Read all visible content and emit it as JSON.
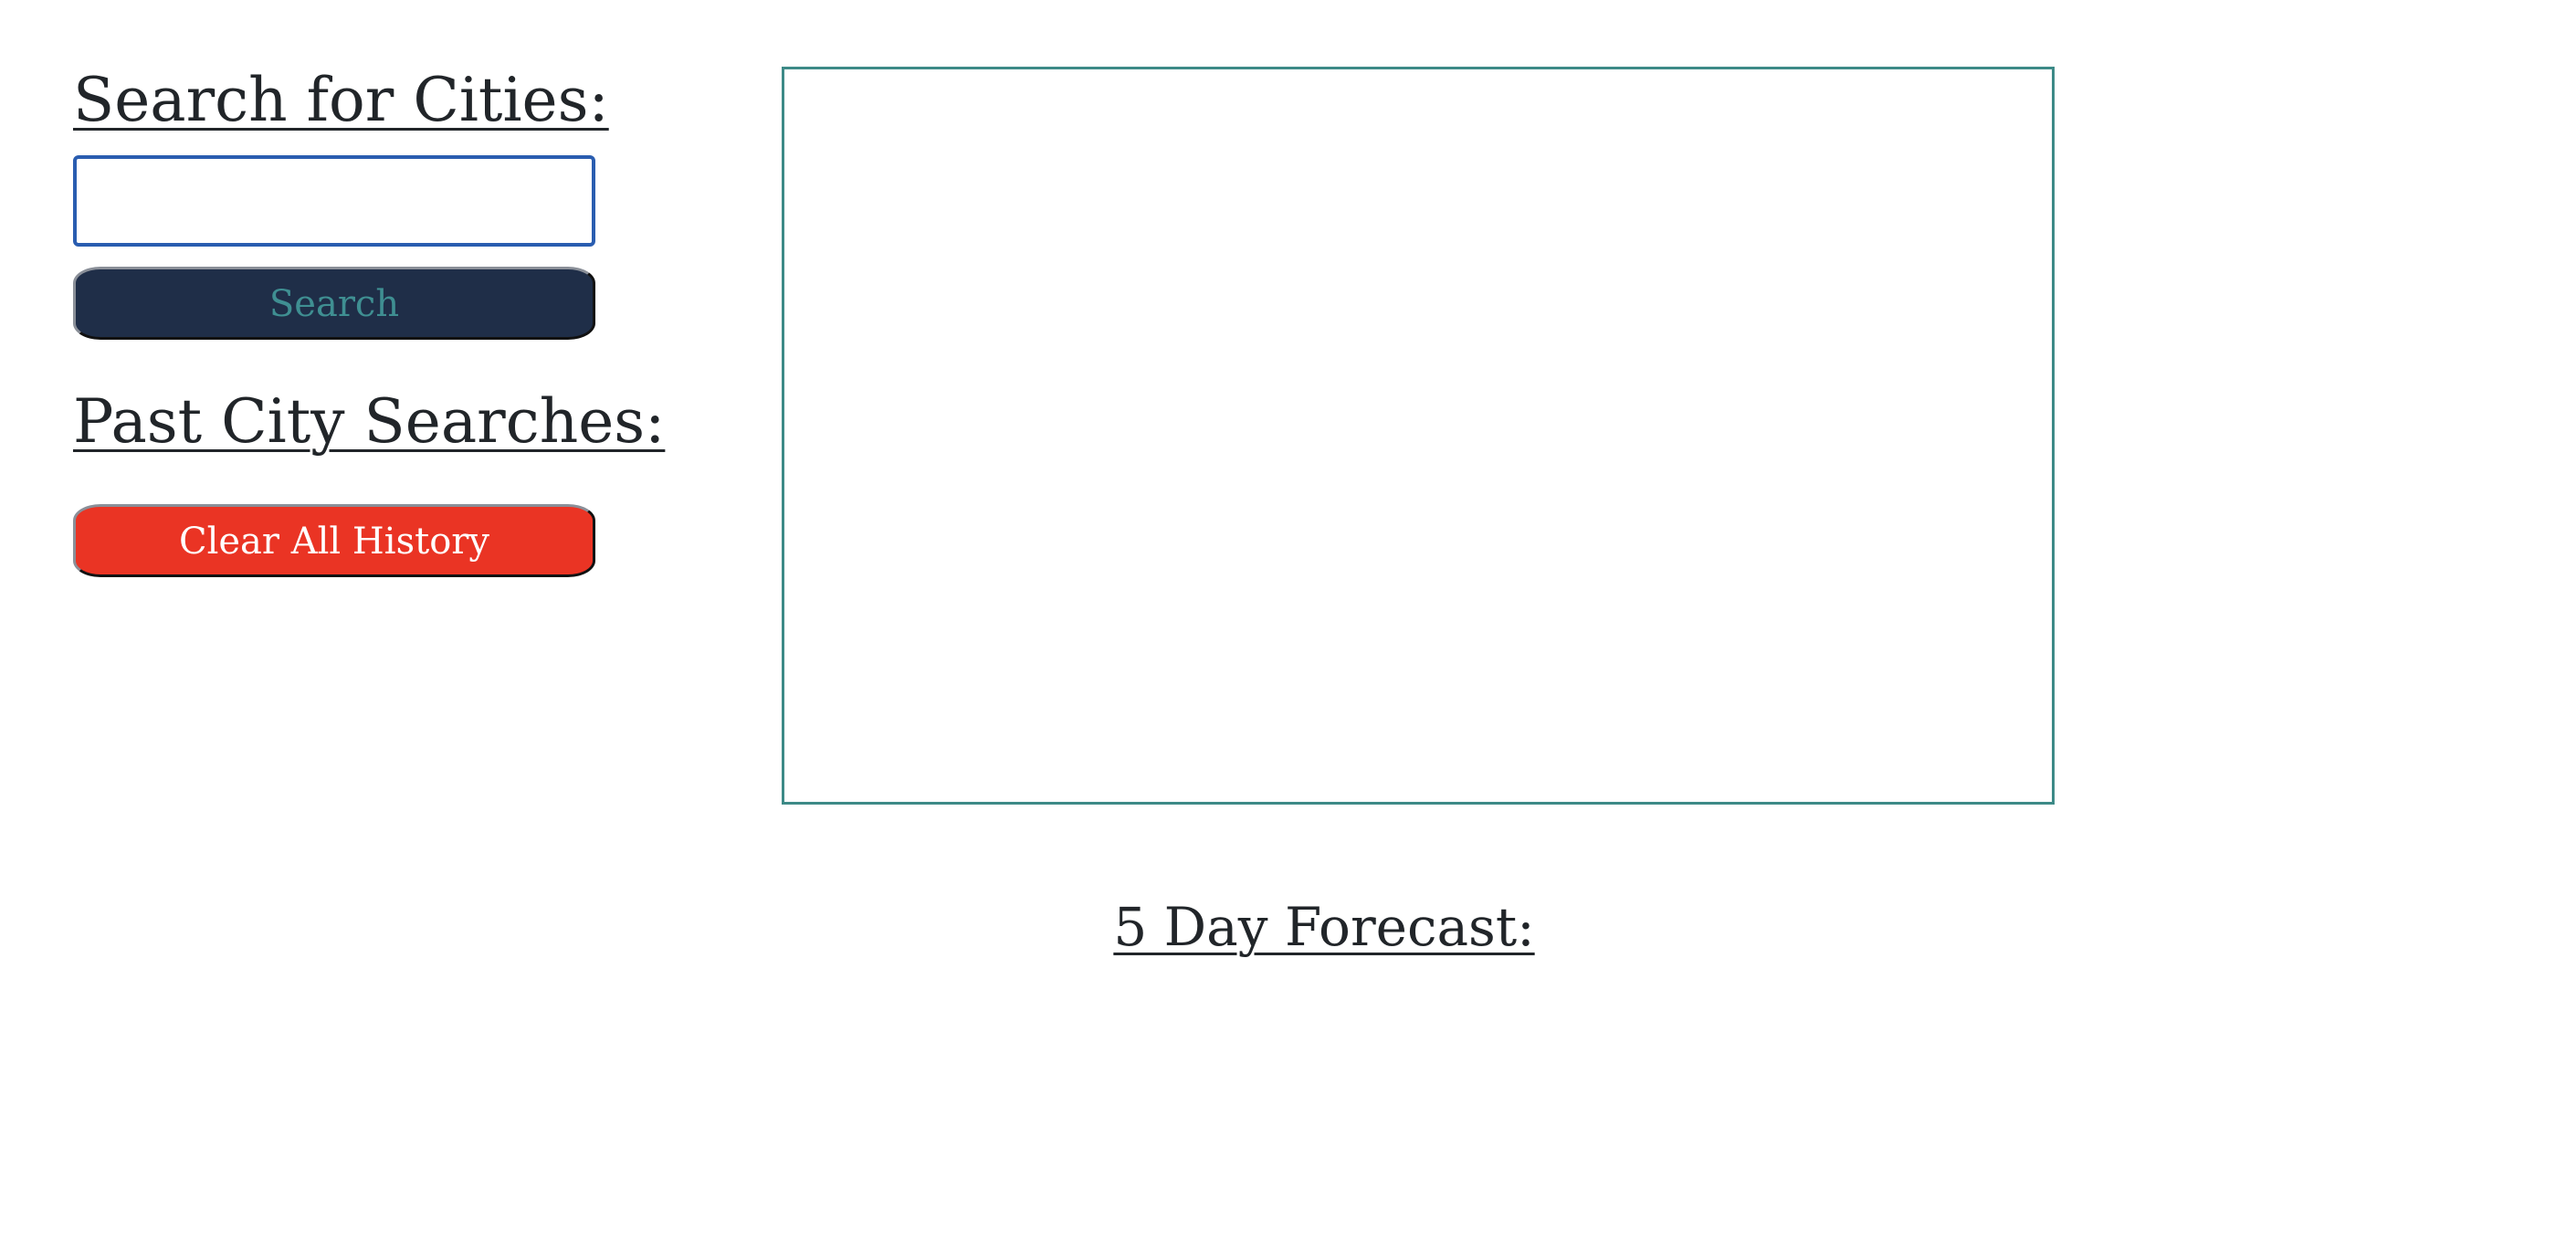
{
  "sidebar": {
    "search_heading": "Search for Cities:",
    "search_input": {
      "value": "",
      "placeholder": ""
    },
    "search_button_label": "Search",
    "past_heading": "Past City Searches:",
    "clear_button_label": "Clear All History"
  },
  "main": {
    "forecast_heading": "5 Day Forecast:"
  },
  "colors": {
    "search_button_bg": "#1f2e48",
    "search_button_text": "#3f8f92",
    "clear_button_bg": "#ea3424",
    "weather_box_border": "#3d8a87",
    "input_focus_border": "#2a5db0"
  }
}
